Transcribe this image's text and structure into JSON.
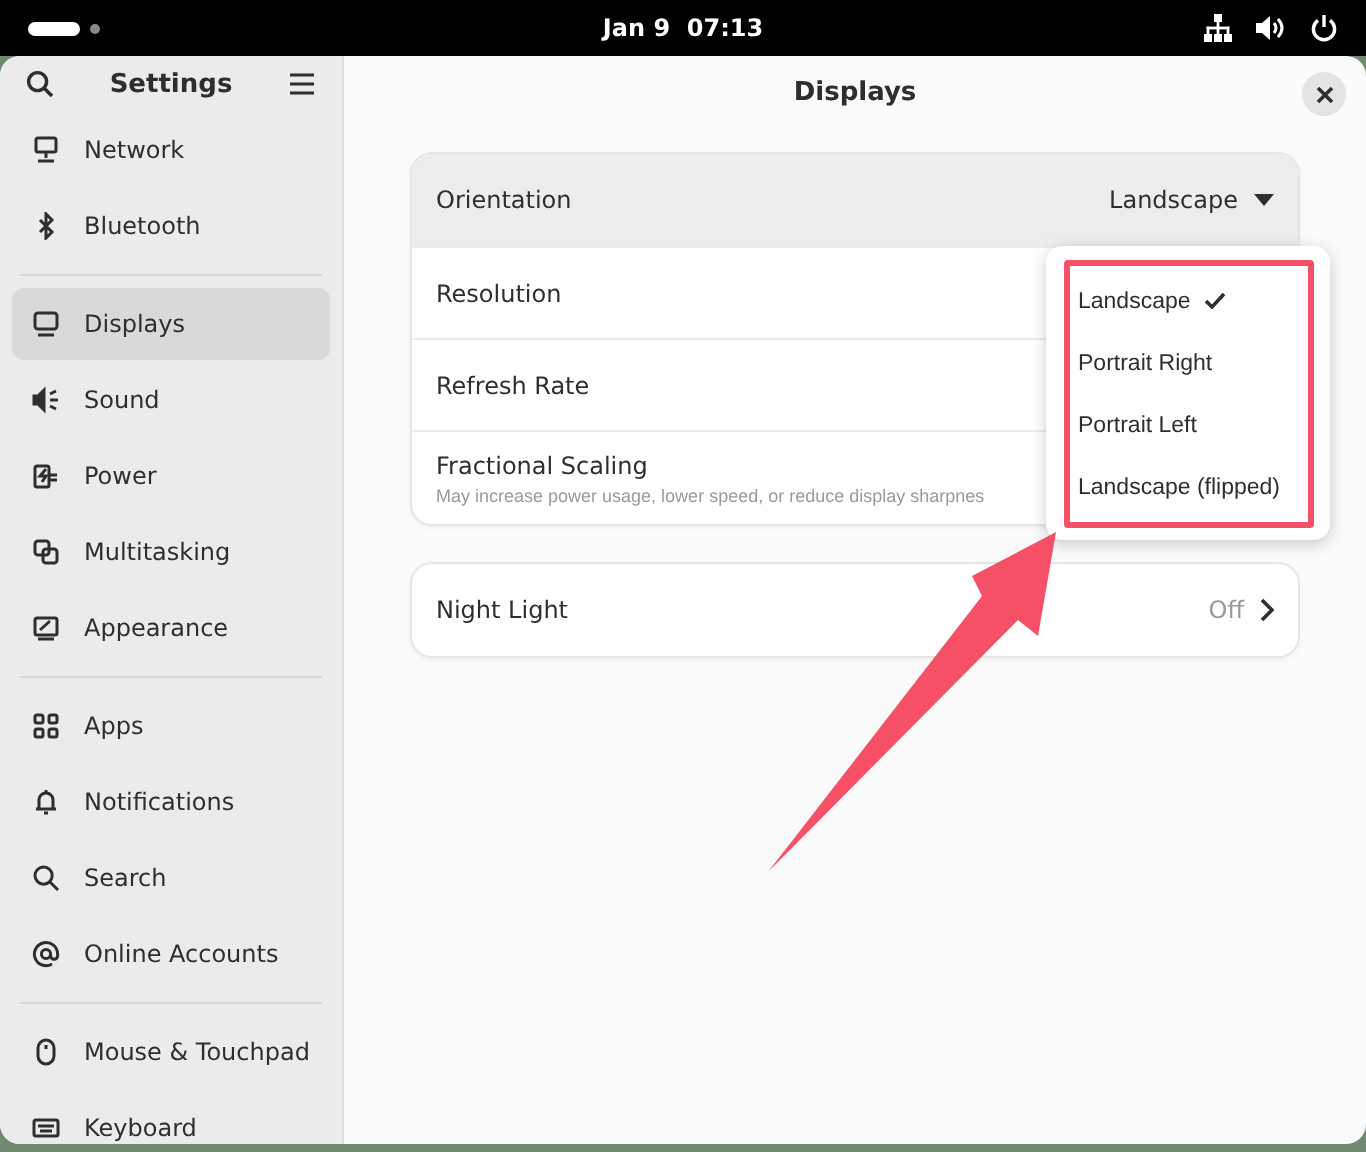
{
  "top_bar": {
    "clock": "Jan 9  07:13"
  },
  "sidebar": {
    "title": "Settings",
    "groups": [
      [
        {
          "label": "Network",
          "selected": false
        },
        {
          "label": "Bluetooth",
          "selected": false
        }
      ],
      [
        {
          "label": "Displays",
          "selected": true
        },
        {
          "label": "Sound",
          "selected": false
        },
        {
          "label": "Power",
          "selected": false
        },
        {
          "label": "Multitasking",
          "selected": false
        },
        {
          "label": "Appearance",
          "selected": false
        }
      ],
      [
        {
          "label": "Apps",
          "selected": false
        },
        {
          "label": "Notifications",
          "selected": false
        },
        {
          "label": "Search",
          "selected": false
        },
        {
          "label": "Online Accounts",
          "selected": false
        }
      ],
      [
        {
          "label": "Mouse & Touchpad",
          "selected": false
        },
        {
          "label": "Keyboard",
          "selected": false
        }
      ]
    ]
  },
  "page": {
    "title": "Displays",
    "display_rows": [
      {
        "kind": "dropdown",
        "label": "Orientation",
        "value": "Landscape",
        "selected": true
      },
      {
        "kind": "plain",
        "label": "Resolution",
        "selected": false
      },
      {
        "kind": "plain",
        "label": "Refresh Rate",
        "selected": false
      },
      {
        "kind": "subtitle",
        "label": "Fractional Scaling",
        "subtitle": "May increase power usage, lower speed, or reduce display sharpnes",
        "selected": false
      }
    ],
    "night_light": {
      "label": "Night Light",
      "value": "Off"
    },
    "orientation_menu": [
      {
        "label": "Landscape",
        "selected": true
      },
      {
        "label": "Portrait Right",
        "selected": false
      },
      {
        "label": "Portrait Left",
        "selected": false
      },
      {
        "label": "Landscape (flipped)",
        "selected": false
      }
    ]
  }
}
